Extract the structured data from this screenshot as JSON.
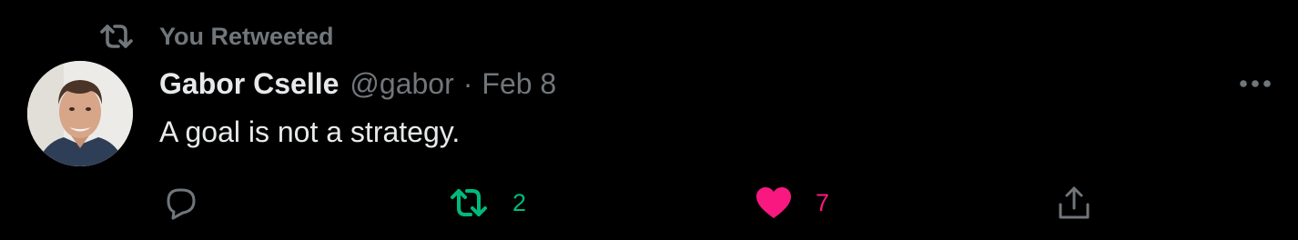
{
  "social_context": {
    "label": "You Retweeted",
    "icon": "retweet-icon",
    "color": "#71767b"
  },
  "tweet": {
    "author": {
      "display_name": "Gabor Cselle",
      "handle": "@gabor",
      "avatar": "avatar-photo"
    },
    "separator": "·",
    "date": "Feb 8",
    "text": "A goal is not a strategy.",
    "more_icon": "more-icon"
  },
  "actions": {
    "reply": {
      "icon": "reply-icon",
      "count": ""
    },
    "retweet": {
      "icon": "retweet-icon",
      "count": "2",
      "active": true,
      "color": "#00ba7c"
    },
    "like": {
      "icon": "heart-icon",
      "count": "7",
      "active": true,
      "color": "#f91880"
    },
    "share": {
      "icon": "share-icon"
    }
  },
  "theme": {
    "background": "#000000",
    "primary_text": "#e7e9ea",
    "secondary_text": "#71767b"
  }
}
